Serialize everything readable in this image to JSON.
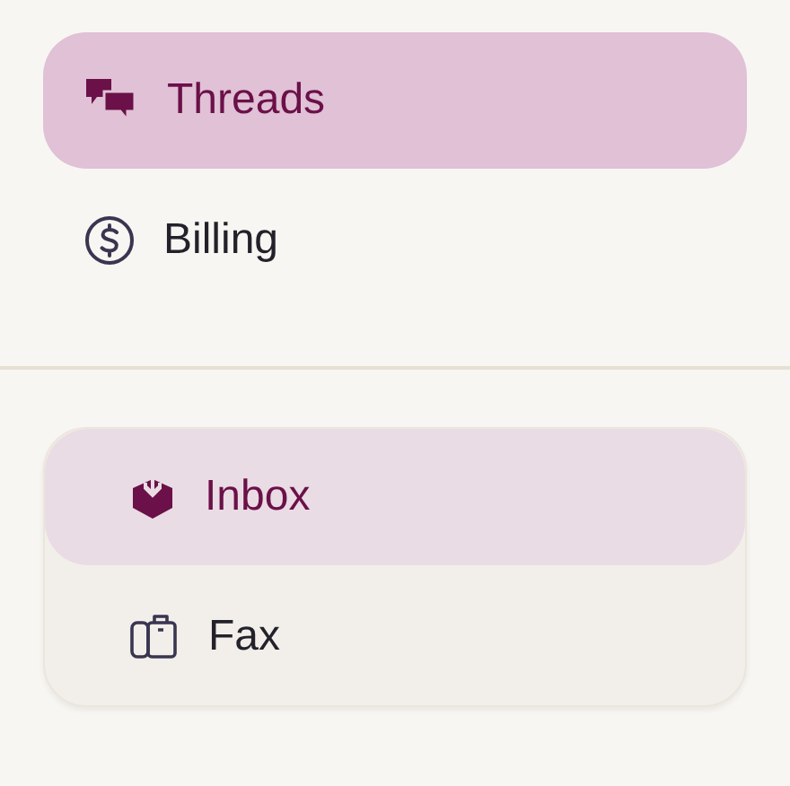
{
  "nav": [
    {
      "kind": "threads",
      "label": "Threads",
      "selected": true
    },
    {
      "kind": "billing",
      "label": "Billing",
      "selected": false
    }
  ],
  "group": [
    {
      "kind": "inbox",
      "label": "Inbox",
      "selected": true
    },
    {
      "kind": "fax",
      "label": "Fax",
      "selected": false
    }
  ]
}
